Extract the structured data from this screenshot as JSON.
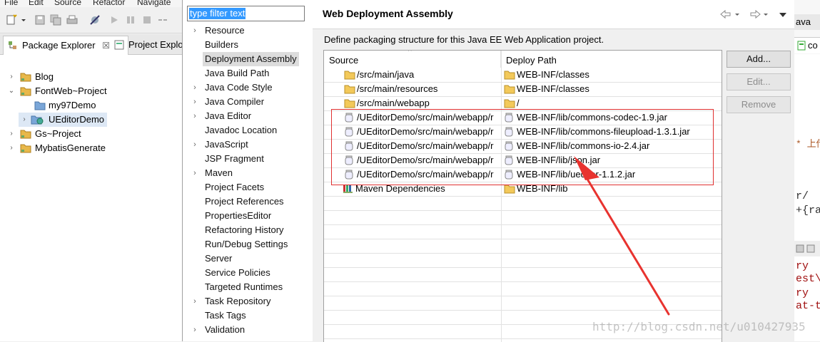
{
  "menubar": {
    "items": [
      "File",
      "Edit",
      "Source",
      "Refactor",
      "Navigate"
    ]
  },
  "explorer": {
    "tab_label": "Package Explorer",
    "tab_close": "☒",
    "tab2_label": "Project Explo",
    "tree": [
      {
        "label": "Blog",
        "twisty": "›",
        "icon": "project"
      },
      {
        "label": "FontWeb~Project",
        "twisty": "⌄",
        "icon": "project"
      },
      {
        "label": "my97Demo",
        "twisty": "",
        "icon": "folder"
      },
      {
        "label": "UEditorDemo",
        "twisty": "›",
        "icon": "webproject"
      },
      {
        "label": "Gs~Project",
        "twisty": "›",
        "icon": "project"
      },
      {
        "label": "MybatisGenerate",
        "twisty": "›",
        "icon": "project"
      }
    ]
  },
  "dialog": {
    "filter_placeholder": "type filter text",
    "nav_items": [
      {
        "label": "Resource",
        "expandable": true
      },
      {
        "label": "Builders",
        "expandable": false
      },
      {
        "label": "Deployment Assembly",
        "expandable": false,
        "selected": true
      },
      {
        "label": "Java Build Path",
        "expandable": false
      },
      {
        "label": "Java Code Style",
        "expandable": true
      },
      {
        "label": "Java Compiler",
        "expandable": true
      },
      {
        "label": "Java Editor",
        "expandable": true
      },
      {
        "label": "Javadoc Location",
        "expandable": false
      },
      {
        "label": "JavaScript",
        "expandable": true
      },
      {
        "label": "JSP Fragment",
        "expandable": false
      },
      {
        "label": "Maven",
        "expandable": true
      },
      {
        "label": "Project Facets",
        "expandable": false
      },
      {
        "label": "Project References",
        "expandable": false
      },
      {
        "label": "PropertiesEditor",
        "expandable": false
      },
      {
        "label": "Refactoring History",
        "expandable": false
      },
      {
        "label": "Run/Debug Settings",
        "expandable": false
      },
      {
        "label": "Server",
        "expandable": false
      },
      {
        "label": "Service Policies",
        "expandable": false
      },
      {
        "label": "Targeted Runtimes",
        "expandable": false
      },
      {
        "label": "Task Repository",
        "expandable": true
      },
      {
        "label": "Task Tags",
        "expandable": false
      },
      {
        "label": "Validation",
        "expandable": true
      }
    ],
    "title": "Web Deployment Assembly",
    "description": "Define packaging structure for this Java EE Web Application project.",
    "table": {
      "col_source": "Source",
      "col_deploy": "Deploy Path",
      "rows": [
        {
          "source": "/src/main/java",
          "source_icon": "folder",
          "deploy": "WEB-INF/classes",
          "deploy_icon": "folder"
        },
        {
          "source": "/src/main/resources",
          "source_icon": "folder",
          "deploy": "WEB-INF/classes",
          "deploy_icon": "folder"
        },
        {
          "source": "/src/main/webapp",
          "source_icon": "folder",
          "deploy": "/",
          "deploy_icon": "folder"
        },
        {
          "source": "/UEditorDemo/src/main/webapp/r",
          "source_icon": "jar",
          "deploy": "WEB-INF/lib/commons-codec-1.9.jar",
          "deploy_icon": "jar"
        },
        {
          "source": "/UEditorDemo/src/main/webapp/r",
          "source_icon": "jar",
          "deploy": "WEB-INF/lib/commons-fileupload-1.3.1.jar",
          "deploy_icon": "jar"
        },
        {
          "source": "/UEditorDemo/src/main/webapp/r",
          "source_icon": "jar",
          "deploy": "WEB-INF/lib/commons-io-2.4.jar",
          "deploy_icon": "jar"
        },
        {
          "source": "/UEditorDemo/src/main/webapp/r",
          "source_icon": "jar",
          "deploy": "WEB-INF/lib/json.jar",
          "deploy_icon": "jar"
        },
        {
          "source": "/UEditorDemo/src/main/webapp/r",
          "source_icon": "jar",
          "deploy": "WEB-INF/lib/ueditor-1.1.2.jar",
          "deploy_icon": "jar"
        },
        {
          "source": "Maven Dependencies",
          "source_icon": "library",
          "deploy": "WEB-INF/lib",
          "deploy_icon": "folder"
        }
      ]
    },
    "buttons": {
      "add": "Add...",
      "edit": "Edit...",
      "remove": "Remove"
    }
  },
  "right_strip": {
    "tab_label": "ava",
    "tab2_label": "co",
    "code_lines": [
      "* 上传",
      "r/",
      "+{ra",
      "ry",
      "est\\",
      "ry",
      "at-t"
    ]
  },
  "watermark": "http://blog.csdn.net/u010427935",
  "colors": {
    "highlight_box": "#e03030",
    "arrow": "#e8332f",
    "selection": "#3399ff"
  }
}
